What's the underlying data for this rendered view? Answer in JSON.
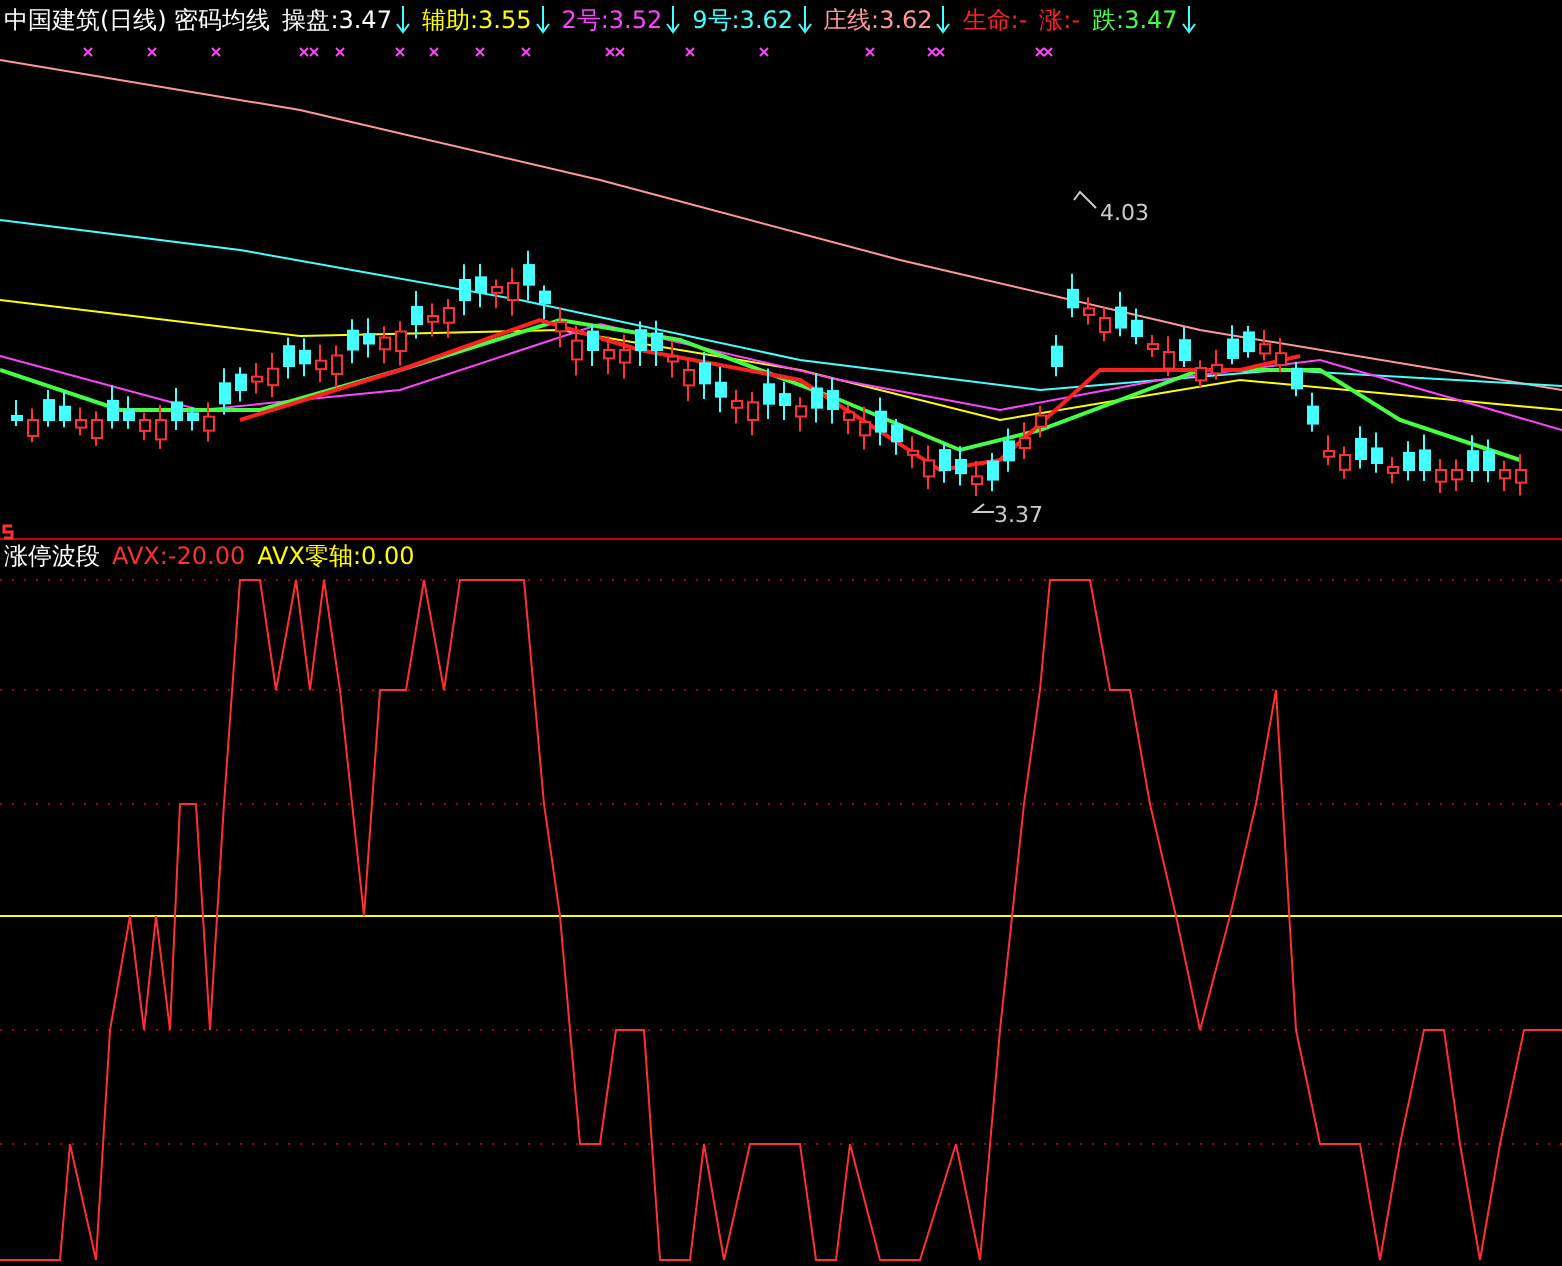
{
  "price_panel": {
    "title": "中国建筑(日线) 密码均线",
    "indicators": [
      {
        "text": "操盘:3.47",
        "color": "#ffffff",
        "arrow": true
      },
      {
        "text": "辅助:3.55",
        "color": "#ffff00",
        "arrow": true
      },
      {
        "text": "2号:3.52",
        "color": "#ff44ff",
        "arrow": true
      },
      {
        "text": "9号:3.62",
        "color": "#44ffff",
        "arrow": true
      },
      {
        "text": "庄线:3.62",
        "color": "#ff9999",
        "arrow": true
      },
      {
        "text": "生命:-",
        "color": "#ff2020",
        "arrow": false
      },
      {
        "text": "涨:-",
        "color": "#ff2020",
        "arrow": false
      },
      {
        "text": "跌:3.47",
        "color": "#44ff44",
        "arrow": true
      }
    ],
    "high_label": "4.03",
    "low_label": "3.37"
  },
  "indicator_panel": {
    "title": "涨停波段",
    "avx": "AVX:-20.00",
    "zero_axis": "AVX零轴:0.00"
  }
}
